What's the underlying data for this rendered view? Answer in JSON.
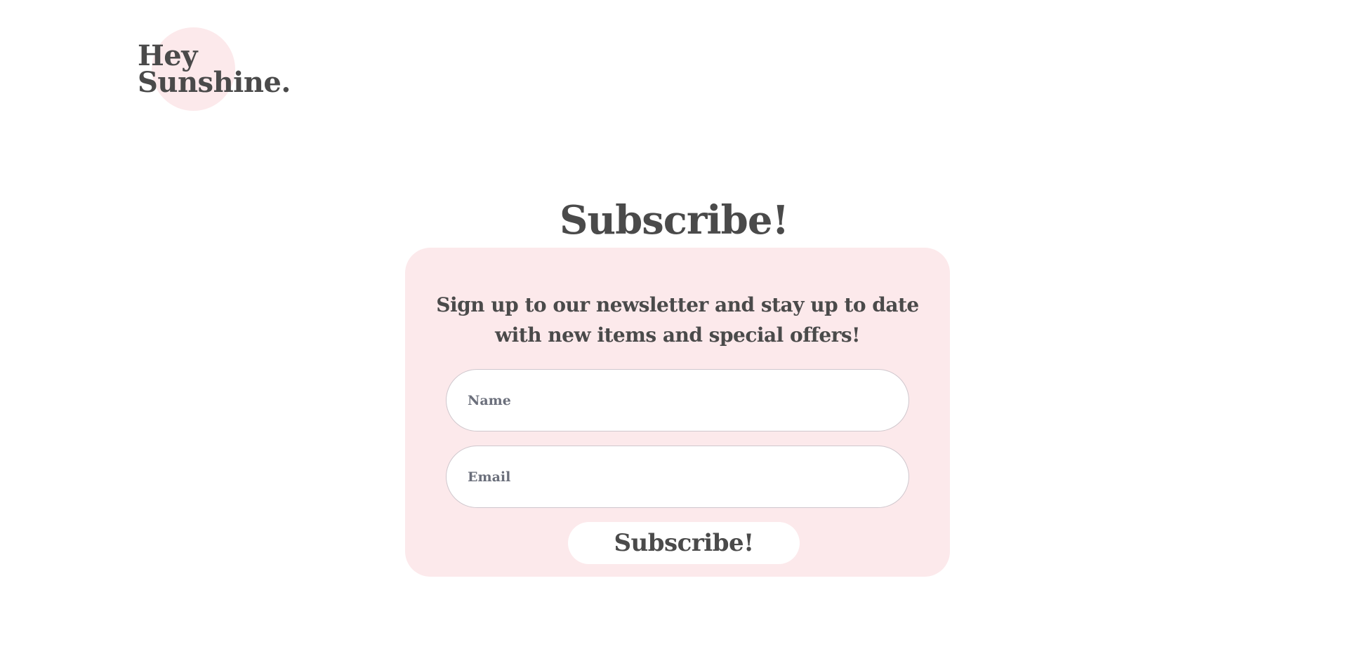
{
  "brand": {
    "line1": "Hey",
    "line2": "Sunshine."
  },
  "page": {
    "title": "Subscribe!"
  },
  "signup": {
    "text_line1": "Sign up to our newsletter and stay up to date",
    "text_line2": "with new items and special offers!",
    "name_placeholder": "Name",
    "name_value": "",
    "email_placeholder": "Email",
    "email_value": "",
    "submit_label": "Subscribe!"
  },
  "colors": {
    "text": "#4a4a4a",
    "accent_pink": "#fce9eb",
    "placeholder": "#6b6f7b",
    "field_border": "#cfc7cd",
    "background": "#ffffff"
  }
}
